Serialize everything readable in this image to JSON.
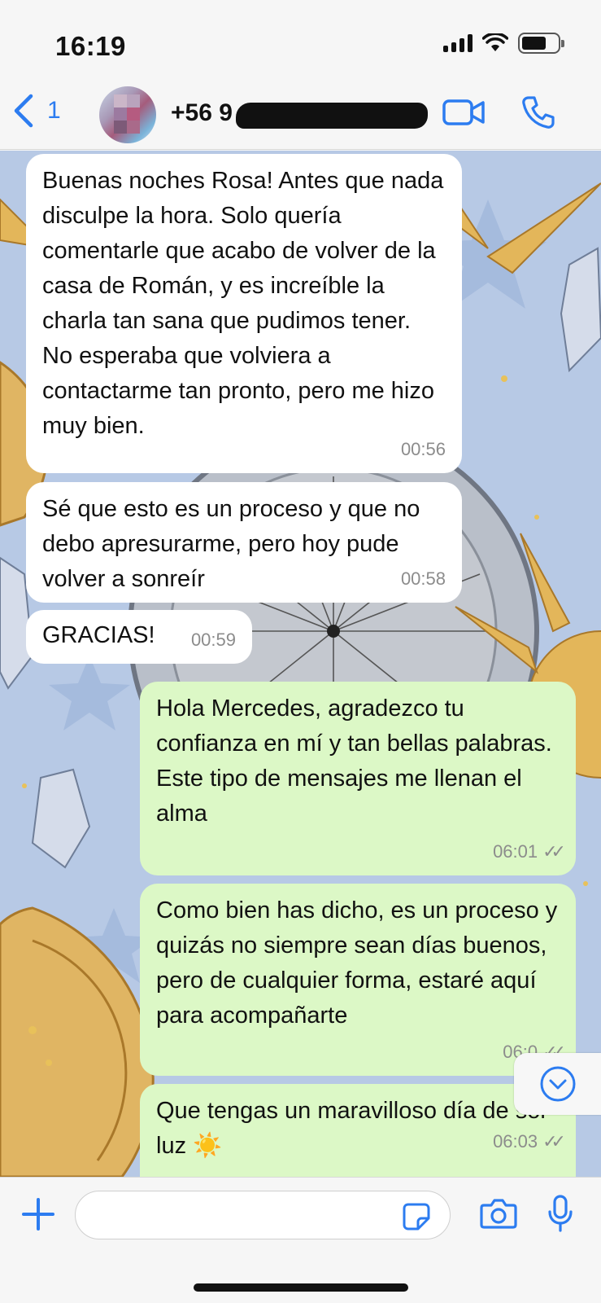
{
  "status_bar": {
    "time": "16:19",
    "battery_level": 0.7
  },
  "header": {
    "back_count": "1",
    "contact_name": "+56 9",
    "accent_color": "#2c7cf0",
    "icons": [
      "chevron-left-icon",
      "video-camera-icon",
      "phone-icon"
    ]
  },
  "messages": [
    {
      "direction": "in",
      "text": "Buenas noches Rosa! Antes que nada disculpe la hora. Solo quería comentarle que acabo de volver de la casa de Román, y es increíble la charla tan sana que pudimos tener. No esperaba que volviera a contactarme tan pronto, pero me hizo muy bien.",
      "time": "00:56"
    },
    {
      "direction": "in",
      "text": "Sé que esto es un proceso y que no debo apresurarme, pero hoy pude volver a sonreír",
      "time": "00:58"
    },
    {
      "direction": "in",
      "text": "GRACIAS!",
      "time": "00:59"
    },
    {
      "direction": "out",
      "text": "Hola Mercedes, agradezco tu confianza en mí y tan bellas palabras.\nEste tipo de mensajes me llenan el alma",
      "time": "06:01",
      "status": "read"
    },
    {
      "direction": "out",
      "text": "Como bien has dicho, es un proceso y quizás no siempre sean días buenos, pero de cualquier forma, estaré aquí para acompañarte",
      "time": "06:0",
      "status": "read"
    },
    {
      "direction": "out",
      "text": "Que tengas un maravilloso día de sol luz ☀️",
      "time": "06:03",
      "status": "read"
    }
  ],
  "colors": {
    "incoming_bubble": "#ffffff",
    "outgoing_bubble": "#dcf8c6",
    "wallpaper": "#b9cbe6"
  },
  "input_bar": {
    "placeholder": "",
    "icons": [
      "plus-icon",
      "sticker-icon",
      "camera-icon",
      "microphone-icon"
    ]
  }
}
